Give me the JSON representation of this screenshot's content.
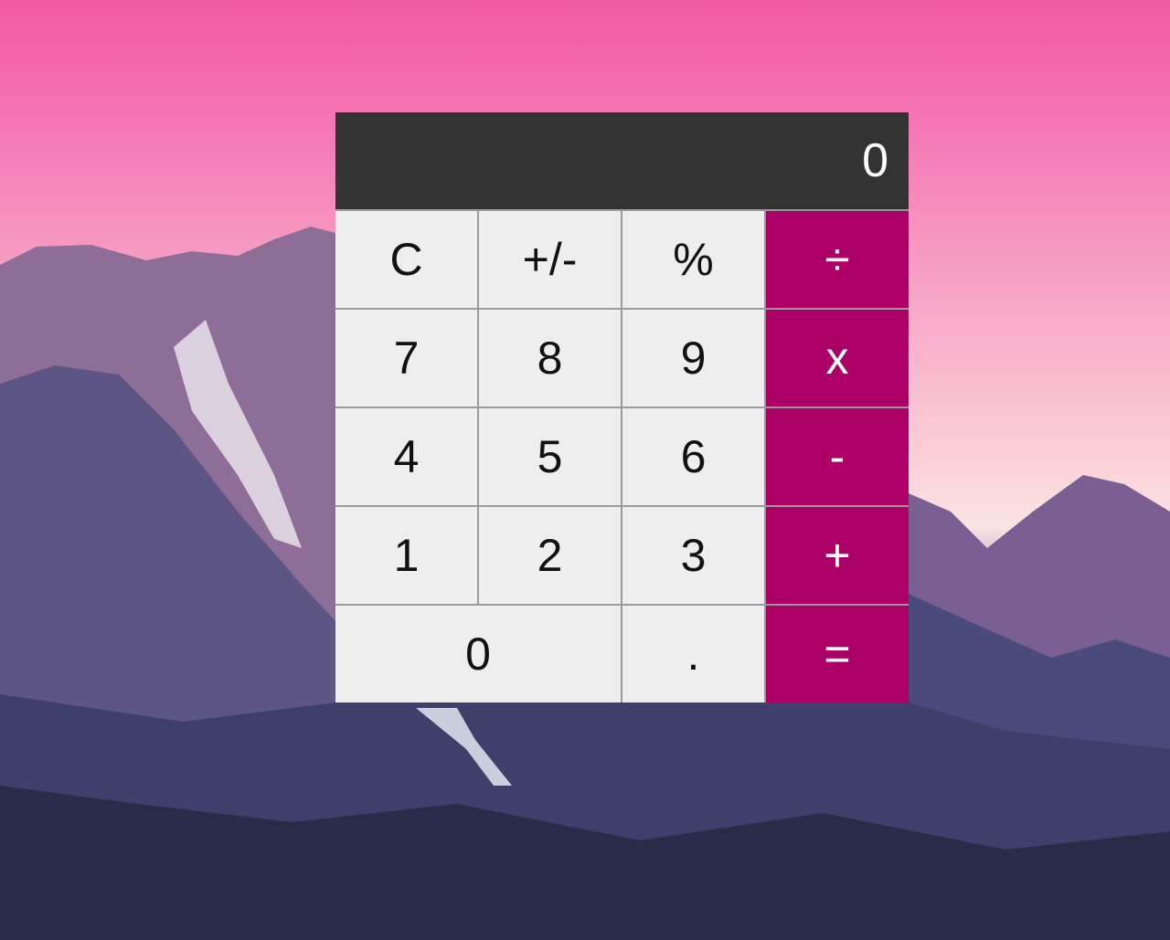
{
  "display": {
    "value": "0"
  },
  "keys": {
    "row1": [
      {
        "label": "C",
        "name": "clear-button"
      },
      {
        "label": "+/-",
        "name": "negate-button"
      },
      {
        "label": "%",
        "name": "percent-button"
      },
      {
        "label": "÷",
        "name": "divide-button"
      }
    ],
    "row2": [
      {
        "label": "7",
        "name": "digit-7-button"
      },
      {
        "label": "8",
        "name": "digit-8-button"
      },
      {
        "label": "9",
        "name": "digit-9-button"
      },
      {
        "label": "x",
        "name": "multiply-button"
      }
    ],
    "row3": [
      {
        "label": "4",
        "name": "digit-4-button"
      },
      {
        "label": "5",
        "name": "digit-5-button"
      },
      {
        "label": "6",
        "name": "digit-6-button"
      },
      {
        "label": "-",
        "name": "subtract-button"
      }
    ],
    "row4": [
      {
        "label": "1",
        "name": "digit-1-button"
      },
      {
        "label": "2",
        "name": "digit-2-button"
      },
      {
        "label": "3",
        "name": "digit-3-button"
      },
      {
        "label": "+",
        "name": "add-button"
      }
    ],
    "row5": [
      {
        "label": "0",
        "name": "digit-0-button"
      },
      {
        "label": ".",
        "name": "decimal-button"
      },
      {
        "label": "=",
        "name": "equals-button"
      }
    ]
  },
  "colors": {
    "display_background": "#333333",
    "key_background": "#eeeeee",
    "operator_background": "#ad0066",
    "operator_text": "#ffffff"
  },
  "background": {
    "description_icon": "mountain-sunset-wallpaper"
  }
}
